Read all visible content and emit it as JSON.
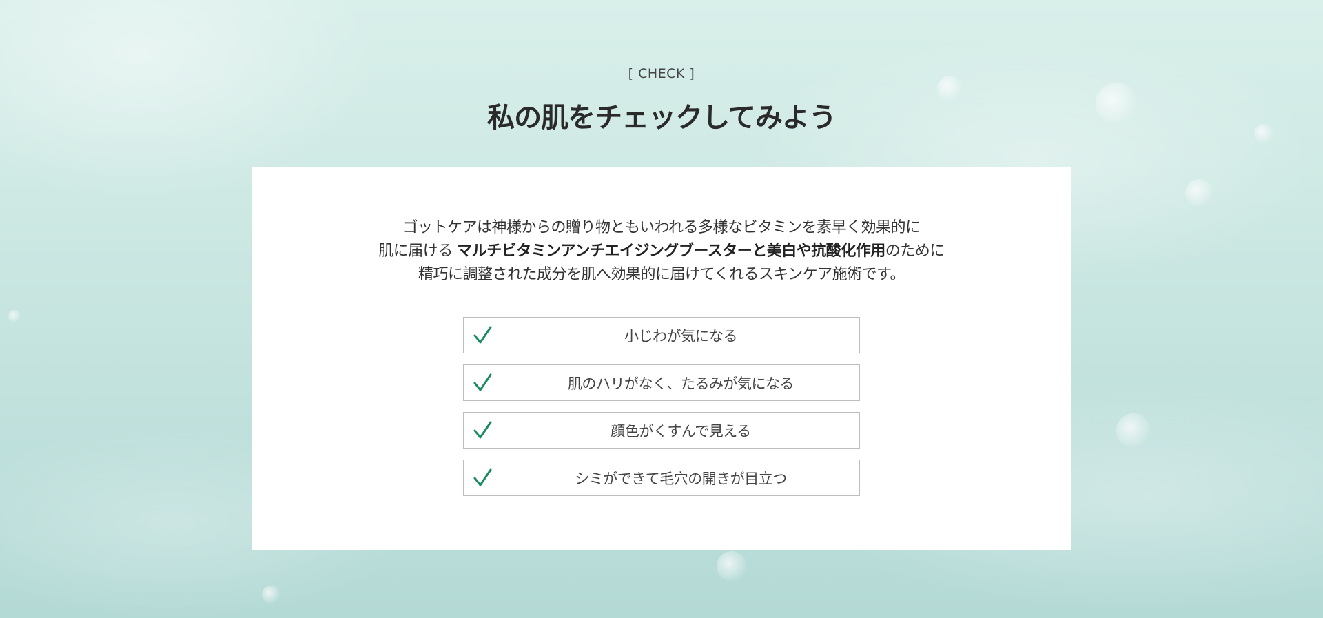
{
  "section": {
    "eyebrow": "[ CHECK ]",
    "title": "私の肌をチェックしてみよう"
  },
  "intro": {
    "line1": "ゴットケアは神様からの贈り物ともいわれる多様なビタミンを素早く効果的に",
    "line2_prefix": "肌に届ける ",
    "line2_bold": "マルチビタミンアンチエイジングブースターと美白や抗酸化作用",
    "line2_suffix": "のために",
    "line3": "精巧に調整された成分を肌へ効果的に届けてくれるスキンケア施術です。"
  },
  "checklist": {
    "icon": "checkmark-icon",
    "accent_color": "#1a8a63",
    "items": [
      {
        "label": "小じわが気になる",
        "checked": true
      },
      {
        "label": "肌のハリがなく、たるみが気になる",
        "checked": true
      },
      {
        "label": "顔色がくすんで見える",
        "checked": true
      },
      {
        "label": "シミができて毛穴の開きが目立つ",
        "checked": true
      }
    ]
  }
}
